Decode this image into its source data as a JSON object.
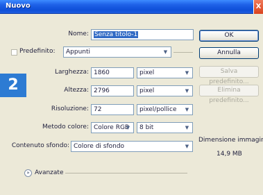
{
  "window": {
    "title": "Nuovo",
    "close_label": "X"
  },
  "step_badge": "2",
  "form": {
    "nome": {
      "label": "Nome:",
      "value": "Senza titolo-1"
    },
    "predefinito": {
      "label": "Predefinito:",
      "value": "Appunti"
    },
    "larghezza": {
      "label": "Larghezza:",
      "value": "1860",
      "unit": "pixel"
    },
    "altezza": {
      "label": "Altezza:",
      "value": "2796",
      "unit": "pixel"
    },
    "risoluzione": {
      "label": "Risoluzione:",
      "value": "72",
      "unit": "pixel/pollice"
    },
    "metodo_colore": {
      "label": "Metodo colore:",
      "value": "Colore RGB",
      "depth": "8 bit"
    },
    "contenuto_sfondo": {
      "label": "Contenuto sfondo:",
      "value": "Colore di sfondo"
    },
    "avanzate_label": "Avanzate"
  },
  "buttons": {
    "ok": "OK",
    "annulla": "Annulla",
    "salva_predefinito": "Salva predefinito...",
    "elimina_predefinito": "Elimina predefinito..."
  },
  "image_size": {
    "label": "Dimensione immagine:",
    "value": "14,9 MB"
  },
  "icons": {
    "combo_arrow": "chevron-down-icon",
    "advanced_toggle": "double-chevron-down-icon"
  },
  "colors": {
    "title_blue": "#0e4fd8",
    "selection_blue": "#316ac5",
    "badge_blue": "#2d7bd3"
  }
}
